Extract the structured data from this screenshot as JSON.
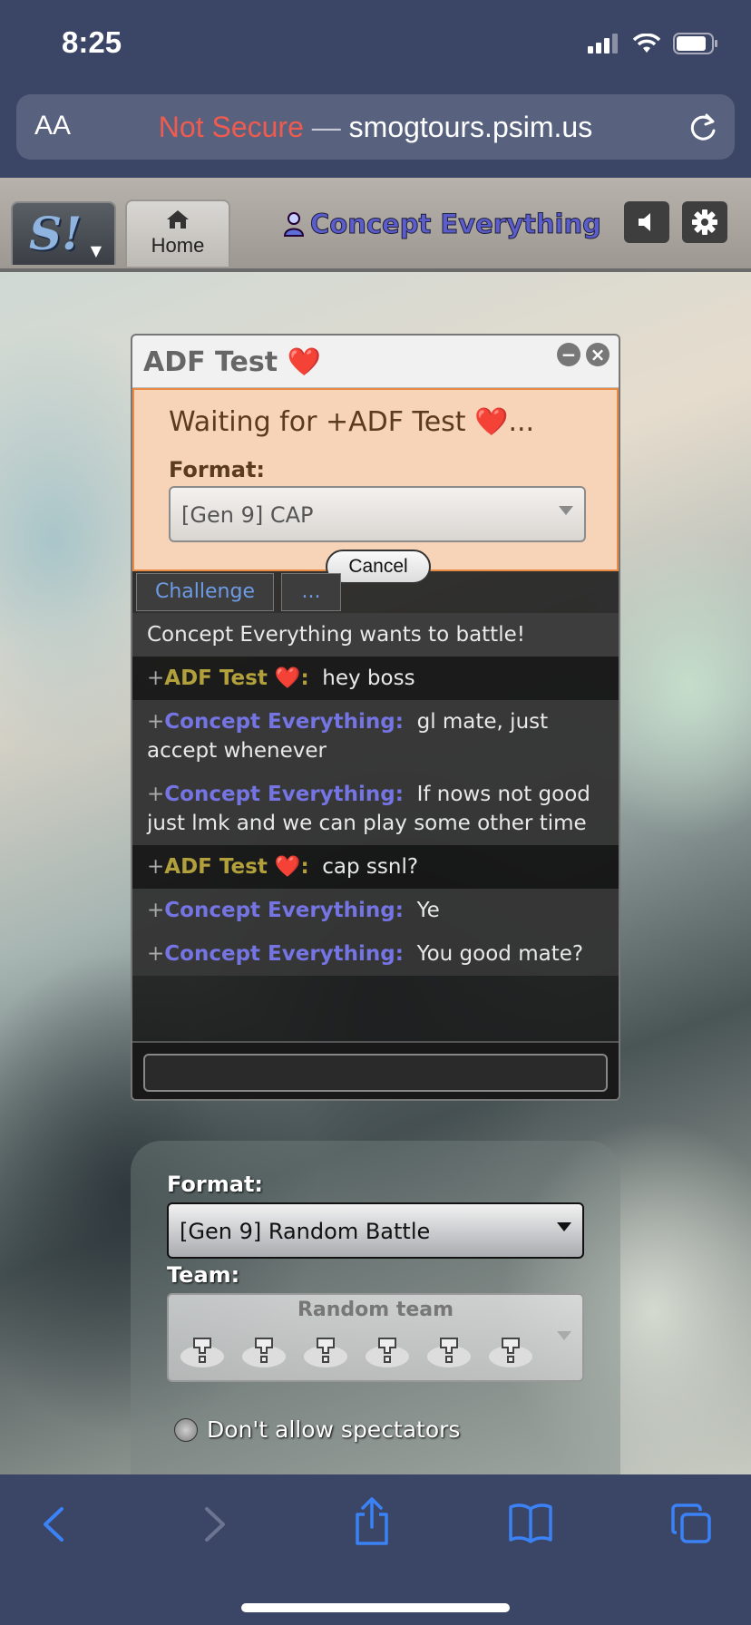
{
  "status_bar": {
    "time": "8:25"
  },
  "address_bar": {
    "aa_label": "AA",
    "not_secure": "Not Secure",
    "separator": "—",
    "domain": "smogtours.psim.us"
  },
  "header": {
    "logo_text": "S!",
    "home_tab_label": "Home",
    "username": "Concept Everything"
  },
  "pm_window": {
    "title": "ADF Test ❤️",
    "challenge": {
      "waiting_text": "Waiting for +ADF Test ❤️...",
      "format_label": "Format:",
      "format_value": "[Gen 9] CAP",
      "cancel_label": "Cancel"
    },
    "tabs": [
      "Challenge",
      "..."
    ],
    "system_message": "Concept Everything wants to battle!",
    "messages": [
      {
        "rank": "+",
        "user": "ADF Test ❤️:",
        "text": "hey boss",
        "user_color": "#b2a03c"
      },
      {
        "rank": "+",
        "user": "Concept Everything:",
        "text": "gl mate, just accept whenever",
        "user_color": "#7574e3"
      },
      {
        "rank": "+",
        "user": "Concept Everything:",
        "text": "If nows not good just lmk and we can play some other time",
        "user_color": "#7574e3"
      },
      {
        "rank": "+",
        "user": "ADF Test ❤️:",
        "text": "cap ssnl?",
        "user_color": "#b2a03c"
      },
      {
        "rank": "+",
        "user": "Concept Everything:",
        "text": "Ye",
        "user_color": "#7574e3"
      },
      {
        "rank": "+",
        "user": "Concept Everything:",
        "text": "You good mate?",
        "user_color": "#7574e3"
      }
    ],
    "chat_input_value": ""
  },
  "battle_form": {
    "format_label": "Format:",
    "format_value": "[Gen 9] Random Battle",
    "team_label": "Team:",
    "team_value": "Random team",
    "spectators_label": "Don't allow spectators"
  },
  "toolbar_icons": [
    "back-icon",
    "forward-icon",
    "share-icon",
    "bookmarks-icon",
    "tabs-icon"
  ],
  "colors": {
    "accent_blue": "#3b82f6",
    "not_secure_red": "#ef5b4e",
    "challenge_bg": "#f7d3b8",
    "challenge_border": "#e88a43"
  }
}
